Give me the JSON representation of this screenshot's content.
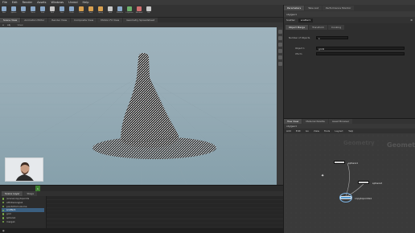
{
  "menu": [
    "File",
    "Edit",
    "Render",
    "Assets",
    "Windows",
    "Unreal",
    "Help"
  ],
  "shelf": {
    "tools": [
      {
        "label": "Box",
        "color": "#8aa8c8"
      },
      {
        "label": "Sphere",
        "color": "#8aa8c8"
      },
      {
        "label": "Tube",
        "color": "#8aa8c8"
      },
      {
        "label": "Torus",
        "color": "#8aa8c8"
      },
      {
        "label": "Grid",
        "color": "#8aa8c8"
      },
      {
        "label": "Null",
        "color": "#c8c8c8"
      },
      {
        "label": "Line",
        "color": "#8aa8c8"
      },
      {
        "label": "Circle",
        "color": "#8aa8c8"
      },
      {
        "label": "Curve",
        "color": "#d8a050"
      },
      {
        "label": "Path",
        "color": "#d8a050"
      },
      {
        "label": "Spray",
        "color": "#d8a050"
      },
      {
        "label": "Font",
        "color": "#c8c8c8"
      },
      {
        "label": "Platonic",
        "color": "#8aa8c8"
      },
      {
        "label": "L-System",
        "color": "#6cb06c"
      },
      {
        "label": "Metaball",
        "color": "#d07070"
      },
      {
        "label": "File",
        "color": "#c8c8c8"
      }
    ]
  },
  "viewport": {
    "tabs": [
      "Scene View",
      "Animation Editor",
      "Render View",
      "Composite View",
      "Motion FX View",
      "Geometry Spreadsheet"
    ],
    "path": "obj",
    "context": "View"
  },
  "timeline": {
    "current_frame": "1"
  },
  "scene_panel": {
    "tabs": [
      "Scene Layer",
      "Stage"
    ],
    "rows": [
      {
        "label": "/scene/copytopoints",
        "selected": false
      },
      {
        "label": "attribwrangle1",
        "selected": false
      },
      {
        "label": "pointsfromvolume",
        "selected": false
      },
      {
        "label": "scatter1",
        "selected": true
      },
      {
        "label": "grid",
        "selected": false
      },
      {
        "label": "sphere1",
        "selected": false
      },
      {
        "label": "merge1",
        "selected": false
      }
    ]
  },
  "parameters": {
    "tabs": [
      "Parameters",
      "Take List",
      "Performance Monitor"
    ],
    "path": "obj/geo1",
    "node_type": "Scatter",
    "node_name": "scatter1",
    "subtabs": [
      "Object Merge",
      "Transform",
      "Cooking"
    ],
    "fields": [
      {
        "label": "Number of Objects",
        "value": "1"
      },
      {
        "label": "Object 1",
        "value": "grid1"
      },
      {
        "label": "Xform",
        "value": ""
      }
    ]
  },
  "network": {
    "tabs": [
      "Tree View",
      "Material Palette",
      "Asset Browser"
    ],
    "path": "obj/geo1",
    "menu": [
      "Add",
      "Edit",
      "Go",
      "View",
      "Tools",
      "Layout",
      "Help"
    ],
    "watermark_left": "Geometry",
    "watermark_right": "Geometry",
    "nodes": [
      {
        "label": "sphere1"
      },
      {
        "label": "sphere2"
      },
      {
        "label": "copytopoints1"
      }
    ]
  },
  "colors": {
    "selected": "#3b5f80",
    "active_node": "#58a0d8"
  }
}
